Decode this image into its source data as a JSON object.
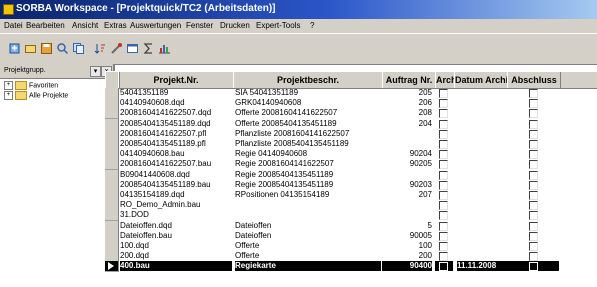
{
  "window": {
    "title": "SORBA Workspace - [Projektquick/TC2 (Arbeitsdaten)]"
  },
  "menu": [
    "Datei",
    "Bearbeiten",
    "Ansicht",
    "Extras",
    "Auswertungen",
    "Fenster",
    "Drucken",
    "Expert-Tools",
    "?"
  ],
  "toolbar": [
    "new-icon",
    "open-icon",
    "save-icon",
    "search-icon",
    "copy-icon",
    "sort-icon",
    "tools-icon",
    "window-icon",
    "sum-icon",
    "chart-icon"
  ],
  "tree": {
    "label": "Projektgrupp.",
    "nodes": [
      {
        "expander": "+",
        "label": "Favoriten"
      },
      {
        "expander": "+",
        "label": "Alle Projekte"
      }
    ]
  },
  "grid": {
    "columns": [
      "Projekt.Nr.",
      "Projektbeschr.",
      "Auftrag Nr.",
      "Archi",
      "Datum Archi",
      "Abschluss"
    ],
    "rows": [
      {
        "nr": "54041351189",
        "beschr": "SIA 54041351189",
        "auftrag": "205"
      },
      {
        "nr": "04140940608.dqd",
        "beschr": "GRK04140940608",
        "auftrag": "206"
      },
      {
        "nr": "20081604141622507.dqd",
        "beschr": "Offerte 20081604141622507",
        "auftrag": "208"
      },
      {
        "nr": "20085404135451189.dqd",
        "beschr": "Offerte 20085404135451189",
        "auftrag": "204"
      },
      {
        "nr": "20081604141622507.pfl",
        "beschr": "Pflanzliste 20081604141622507",
        "auftrag": ""
      },
      {
        "nr": "20085404135451189.pfl",
        "beschr": "Pflanzliste 20085404135451189",
        "auftrag": ""
      },
      {
        "nr": "04140940608.bau",
        "beschr": "Regie 04140940608",
        "auftrag": "90204"
      },
      {
        "nr": "20081604141622507.bau",
        "beschr": "Regie 20081604141622507",
        "auftrag": "90205"
      },
      {
        "nr": "B09041440608.dqd",
        "beschr": "Regie 20085404135451189",
        "auftrag": ""
      },
      {
        "nr": "20085404135451189.bau",
        "beschr": "Regie 20085404135451189",
        "auftrag": "90203"
      },
      {
        "nr": "04135154189.dqd",
        "beschr": "RPositionen 04135154189",
        "auftrag": "207"
      },
      {
        "nr": "RO_Demo_Admin.bau",
        "beschr": "",
        "auftrag": ""
      },
      {
        "nr": "31.DOD",
        "beschr": "",
        "auftrag": ""
      },
      {
        "nr": "Dateioffen.dqd",
        "beschr": "Dateioffen",
        "auftrag": "5"
      },
      {
        "nr": "Dateioffen.bau",
        "beschr": "Dateioffen",
        "auftrag": "90005"
      },
      {
        "nr": "100.dqd",
        "beschr": "Offerte",
        "auftrag": "100"
      },
      {
        "nr": "200.dqd",
        "beschr": "Offerte",
        "auftrag": "200"
      }
    ],
    "highlight_row": {
      "nr": "400.bau",
      "beschr": "Regiekarte",
      "auftrag": "90400",
      "datum": "11.11.2008"
    }
  },
  "colors": {
    "title_start": "#0a246a",
    "title_end": "#a6caf0",
    "chrome": "#d4d0c8",
    "highlight": "#000000"
  }
}
